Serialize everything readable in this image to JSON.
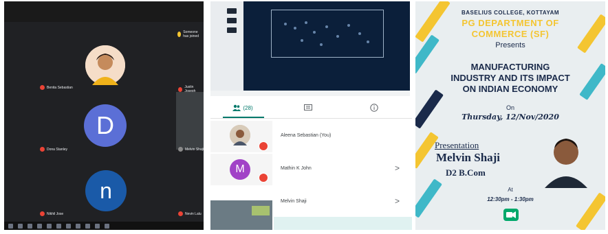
{
  "call": {
    "participants": [
      {
        "name": "Benita Sebastian",
        "initial": ""
      },
      {
        "name": "Dona Stanley",
        "initial": "D"
      },
      {
        "name": "Nikhil Jose",
        "initial": "n"
      }
    ],
    "side_names": [
      "Justin Joseph",
      "Melvin Shaji",
      "Nevin Lalu"
    ],
    "top_notice": "Someone has joined"
  },
  "phone": {
    "tab_people": "(28)",
    "participants": [
      {
        "name": "Aleena Sebastian (You)",
        "initial": ""
      },
      {
        "name": "Mathin K John",
        "initial": "M"
      },
      {
        "name": "Melvin Shaji",
        "initial": ""
      }
    ],
    "chevron": ">"
  },
  "poster": {
    "college": "BASELIUS COLLEGE, KOTTAYAM",
    "department_line1": "PG DEPARTMENT OF",
    "department_line2": "COMMERCE (SF)",
    "presents": "Presents",
    "title_line1": "MANUFACTURING",
    "title_line2": "INDUSTRY AND ITS IMPACT",
    "title_line3": "ON INDIAN ECONOMY",
    "on": "On",
    "date": "Thursday, 12/Nov/2020",
    "presentation_label": "Presentation",
    "presenter_name": "Melvin Shaji",
    "presenter_class": "D2 B.Com",
    "at": "At",
    "time": "12:30pm - 1:30pm"
  },
  "colors": {
    "teal": "#00796b",
    "poster_title": "#1a2a4a",
    "dept_yellow": "#f4c531",
    "record_red": "#ea4335",
    "avatar_blue": "#5b6fd6",
    "avatar_navy": "#1a5aa8",
    "avatar_purple": "#a142c7"
  }
}
